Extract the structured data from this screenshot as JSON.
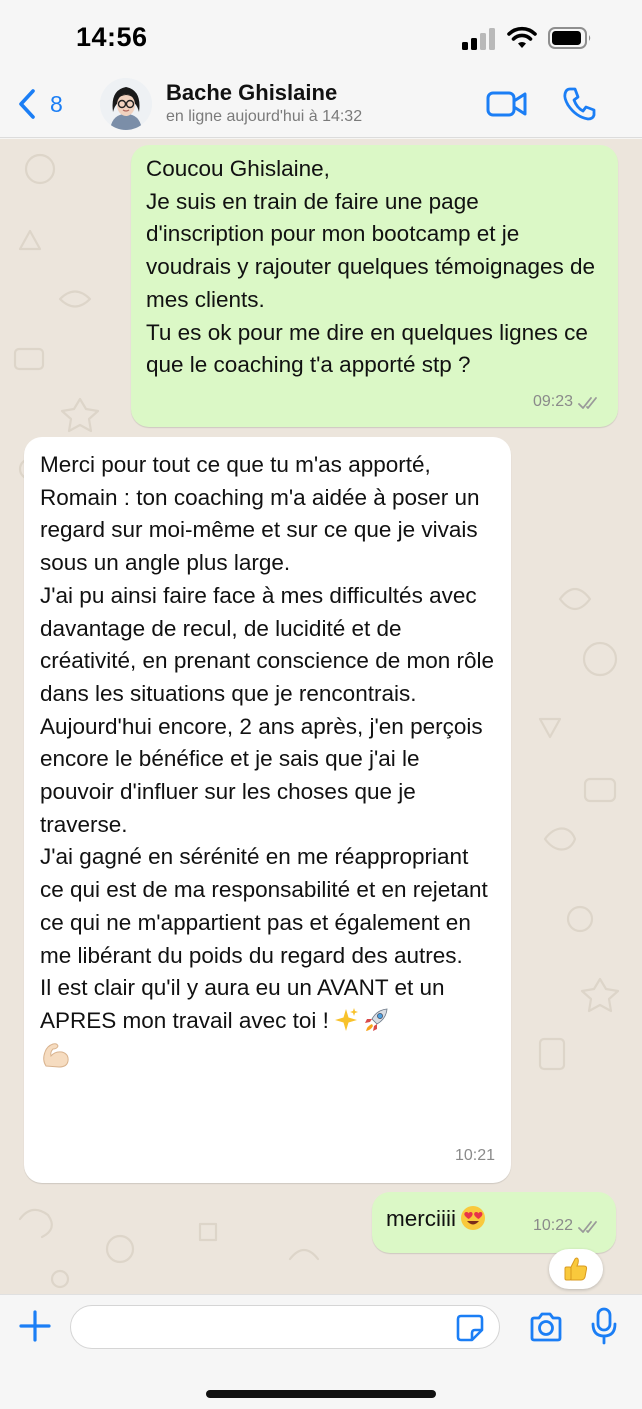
{
  "status_bar": {
    "time": "14:56",
    "icons": [
      "signal-icon",
      "wifi-icon",
      "battery-icon"
    ]
  },
  "header": {
    "back_count": "8",
    "contact_name": "Bache Ghislaine",
    "contact_status": "en ligne aujourd'hui à 14:32",
    "icons": [
      "chevron-left-icon",
      "video-camera-icon",
      "phone-icon"
    ],
    "accent_color": "#1b7ef5"
  },
  "messages": [
    {
      "direction": "out",
      "text": "Coucou Ghislaine,\nJe suis en train de faire une page d'inscription pour mon bootcamp et je voudrais y rajouter quelques témoignages de mes clients.\nTu es ok pour me dire en quelques lignes ce que le coaching t'a apporté stp ?",
      "time": "09:23",
      "status": "read"
    },
    {
      "direction": "in",
      "text": "Merci pour tout ce que tu m'as apporté, Romain : ton coaching m'a aidée à poser un regard sur moi-même et sur ce que je vivais sous un angle plus large.\nJ'ai pu ainsi faire face à mes difficultés avec davantage de recul, de lucidité et de créativité, en prenant conscience de mon rôle dans les situations que je rencontrais.\nAujourd'hui encore, 2 ans après, j'en perçois encore le bénéfice et je sais que j'ai le pouvoir d'influer sur les choses que je traverse.\nJ'ai gagné en sérénité en me réappropriant ce qui est de ma responsabilité et en rejetant ce qui ne m'appartient pas et également en me libérant du poids du regard des autres.\nIl est clair qu'il y aura eu un AVANT et un APRES mon travail avec toi !",
      "emojis": [
        "sparkles-emoji",
        "rocket-emoji",
        "flexed-biceps-emoji"
      ],
      "time": "10:21"
    },
    {
      "direction": "out",
      "text": "merciiii",
      "emojis": [
        "heart-eyes-emoji"
      ],
      "time": "10:22",
      "status": "read",
      "reaction": "thumbs-up-emoji"
    }
  ],
  "composer": {
    "placeholder": "",
    "icons": [
      "plus-icon",
      "sticker-icon",
      "camera-icon",
      "microphone-icon"
    ]
  },
  "colors": {
    "outgoing_bubble": "#dbf8c6",
    "incoming_bubble": "#ffffff",
    "chat_background": "#ece5dc"
  }
}
